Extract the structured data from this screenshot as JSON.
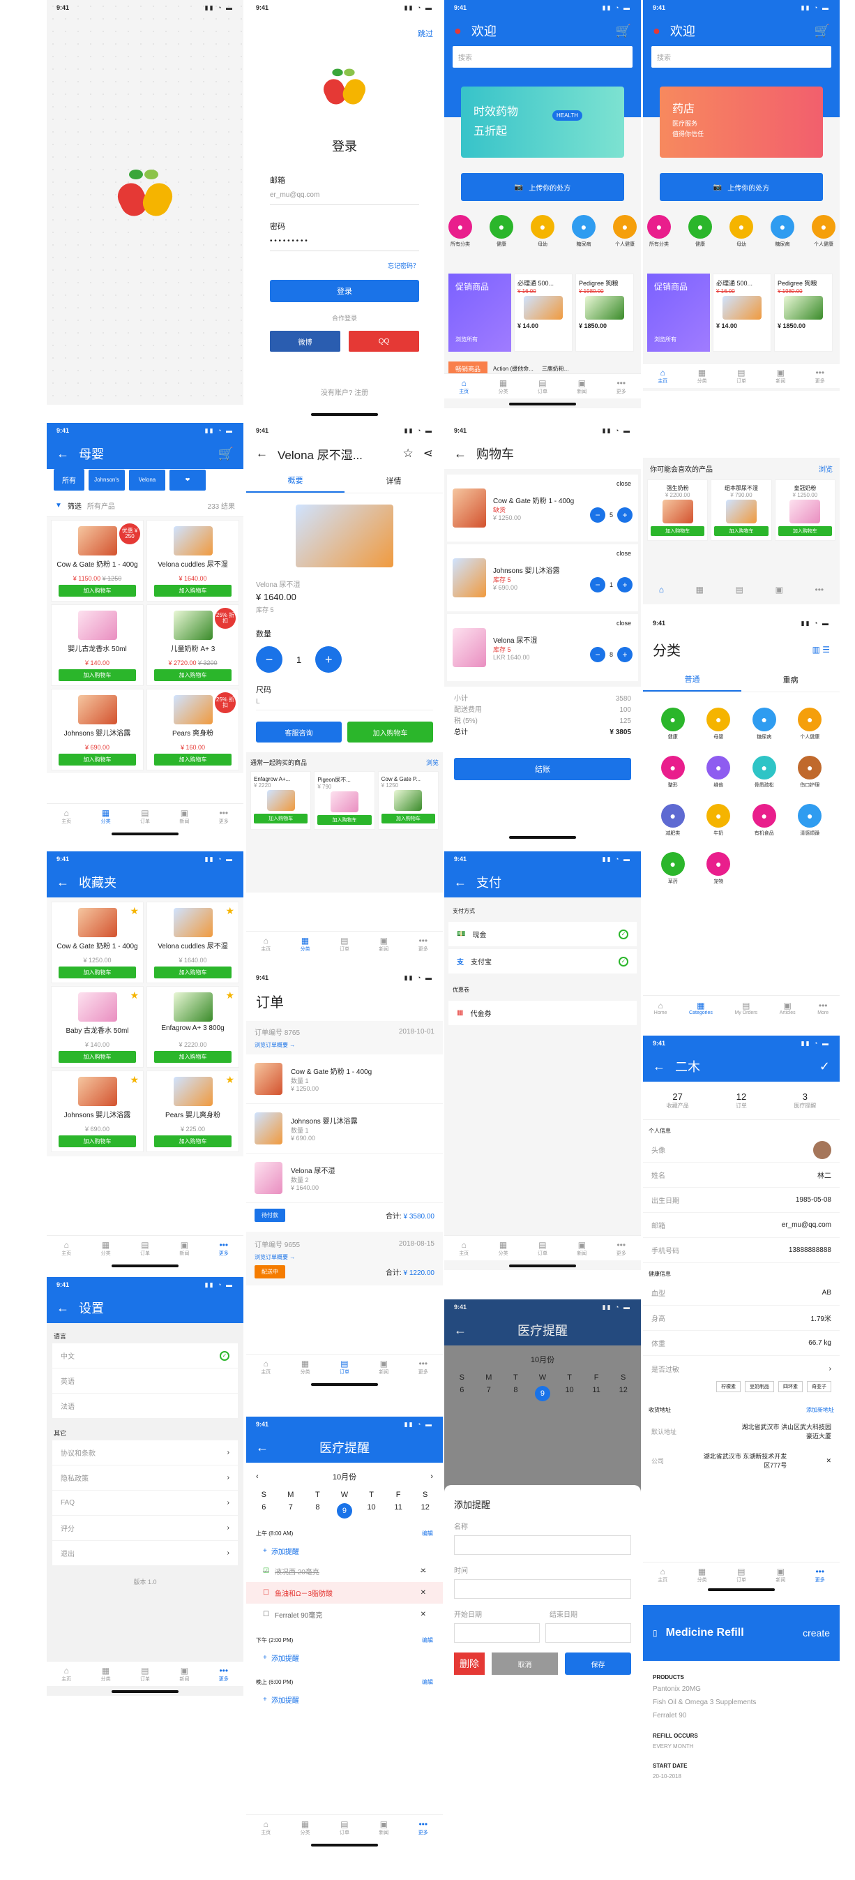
{
  "status_time": "9:41",
  "splash": {},
  "login": {
    "skip": "跳过",
    "title": "登录",
    "email_label": "邮箱",
    "email_value": "er_mu@qq.com",
    "password_label": "密码",
    "password_dots": "• • • • • • • • •",
    "forgot": "忘记密码？",
    "login_btn": "登录",
    "partner": "合作登录",
    "weibo": "微博",
    "qq": "QQ",
    "register": "没有账户? 注册"
  },
  "home1": {
    "title": "欢迎",
    "search": "搜索",
    "banner_line1": "时效药物",
    "banner_line2": "五折起",
    "banner_tag": "HEALTH",
    "upload": "上传你的处方"
  },
  "home2": {
    "title": "欢迎",
    "search": "搜索",
    "banner_line1": "药店",
    "banner_line2": "医疗服务",
    "banner_line3": "值得你信任",
    "upload": "上传你的处方"
  },
  "home_cats": [
    "所有分类",
    "健康",
    "母幼",
    "糖尿病",
    "个人健康"
  ],
  "promo": {
    "title": "促销商品",
    "see_all": "浏览所有",
    "items": [
      {
        "name": "必理通 500...",
        "old": "¥ 16.00",
        "price": "¥ 14.00"
      },
      {
        "name": "Pedigree 狗粮",
        "old": "¥ 1980.00",
        "price": "¥ 1850.00"
      }
    ]
  },
  "home1_extra": {
    "tag": "畅销商品",
    "item1": "Action (缓他命...",
    "item2": "三鹿奶粉..."
  },
  "tabs": {
    "home": "主页",
    "cat": "分类",
    "orders": "订单",
    "news": "新闻",
    "more": "更多"
  },
  "tabs_en": {
    "home": "Home",
    "cat": "Categories",
    "orders": "My Orders",
    "news": "Articles",
    "more": "More"
  },
  "mother": {
    "title": "母婴",
    "tab_all": "所有",
    "filter": "筛选",
    "all_products": "所有产品",
    "count": "233 结果",
    "add": "加入购物车",
    "items": [
      {
        "name": "Cow & Gate 奶粉 1 - 400g",
        "price": "¥ 1150.00",
        "old": "¥ 1250",
        "badge": "优惠 ¥ 250"
      },
      {
        "name": "Velona cuddles 尿不湿",
        "price": "¥ 1640.00",
        "old": "",
        "badge": ""
      },
      {
        "name": "婴儿古龙香水 50ml",
        "price": "¥ 140.00",
        "old": "",
        "badge": ""
      },
      {
        "name": "儿童奶粉 A+ 3",
        "price": "¥ 2720.00",
        "old": "¥ 3200",
        "badge": "25% 折扣"
      },
      {
        "name": "Johnsons 婴儿沐浴露",
        "price": "¥ 690.00",
        "old": "",
        "badge": ""
      },
      {
        "name": "Pears 爽身粉",
        "price": "¥ 160.00",
        "old": "",
        "badge": "25% 折扣"
      }
    ]
  },
  "detail": {
    "title": "Velona 尿不湿...",
    "tab1": "概要",
    "tab2": "详情",
    "name": "Velona 尿不湿",
    "price": "¥ 1640.00",
    "stock": "库存 5",
    "qty_label": "数量",
    "qty": "1",
    "size_label": "尺码",
    "size": "L",
    "service": "客服咨询",
    "add": "加入购物车",
    "together": "通常一起购买的商品",
    "browse": "浏览",
    "related": [
      {
        "name": "Enfagrow A+...",
        "price": "¥ 2220"
      },
      {
        "name": "Pigeon尿不...",
        "price": "¥ 790"
      },
      {
        "name": "Cow & Gate P...",
        "price": "¥ 1250"
      }
    ]
  },
  "cart": {
    "title": "购物车",
    "close": "close",
    "items": [
      {
        "name": "Cow & Gate 奶粉 1 - 400g",
        "stock": "缺货",
        "price": "¥ 1250.00",
        "qty": "5"
      },
      {
        "name": "Johnsons 婴儿沐浴露",
        "stock": "库存 5",
        "price": "¥ 690.00",
        "qty": "1"
      },
      {
        "name": "Velona 尿不湿",
        "stock": "库存 5",
        "price": "LKR 1640.00",
        "qty": "8"
      }
    ],
    "subtotal_l": "小计",
    "subtotal": "3580",
    "ship_l": "配送费用",
    "ship": "100",
    "tax_l": "税 (5%)",
    "tax": "125",
    "total_l": "总计",
    "total": "¥ 3805",
    "checkout": "结账"
  },
  "recommend": {
    "title": "你可能会喜欢的产品",
    "browse": "浏览",
    "items": [
      {
        "name": "强生奶粉",
        "price": "¥ 2200.00"
      },
      {
        "name": "纽本那尿不湿",
        "price": "¥ 790.00"
      },
      {
        "name": "皇冠奶粉",
        "price": "¥ 1250.00"
      }
    ],
    "add": "加入购物车"
  },
  "category": {
    "title": "分类",
    "tab1": "普通",
    "tab2": "重病",
    "items": [
      "健康",
      "母婴",
      "糖尿病",
      "个人健康",
      "整形",
      "维他",
      "骨质疏松",
      "伤口护理",
      "减肥类",
      "牛奶",
      "有机食品",
      "清感烦躁",
      "草药",
      "宠物"
    ]
  },
  "favorites": {
    "title": "收藏夹",
    "add": "加入购物车",
    "items": [
      {
        "name": "Cow & Gate 奶粉 1 - 400g",
        "price": "¥ 1250.00"
      },
      {
        "name": "Velona cuddles 尿不湿",
        "price": "¥ 1640.00"
      },
      {
        "name": "Baby 古龙香水 50ml",
        "price": "¥ 140.00"
      },
      {
        "name": "Enfagrow A+ 3 800g",
        "price": "¥ 2220.00"
      },
      {
        "name": "Johnsons 婴儿沐浴露",
        "price": "¥ 690.00"
      },
      {
        "name": "Pears 婴儿爽身粉",
        "price": "¥ 225.00"
      }
    ]
  },
  "orders": {
    "title": "订单",
    "o1": "订单编号 8765",
    "d1": "2018-10-01",
    "view": "浏览订单概要 →",
    "items": [
      {
        "name": "Cow & Gate 奶粉 1 - 400g",
        "qty": "数量 1",
        "price": "¥ 1250.00"
      },
      {
        "name": "Johnsons 婴儿沐浴露",
        "qty": "数量 1",
        "price": "¥ 690.00"
      },
      {
        "name": "Velona 尿不湿",
        "qty": "数量 2",
        "price": "¥ 1640.00"
      }
    ],
    "status1": "待付款",
    "total1_l": "合计:",
    "total1": "¥ 3580.00",
    "o2": "订单编号 9655",
    "d2": "2018-08-15",
    "status2": "配送中",
    "total2": "¥ 1220.00"
  },
  "pay": {
    "title": "支付",
    "method": "支付方式",
    "cash": "现金",
    "alipay": "支付宝",
    "coupon_l": "优惠卷",
    "coupon": "代金券"
  },
  "profile": {
    "name": "二木",
    "s1": "27",
    "s1l": "收藏产品",
    "s2": "12",
    "s2l": "订单",
    "s3": "3",
    "s3l": "医疗提醒",
    "personal": "个人信息",
    "avatar_l": "头像",
    "name_l": "姓名",
    "name_v": "林二",
    "dob_l": "出生日期",
    "dob": "1985-05-08",
    "email_l": "邮箱",
    "email": "er_mu@qq.com",
    "phone_l": "手机号码",
    "phone": "13888888888",
    "health": "健康信息",
    "blood_l": "血型",
    "blood": "AB",
    "height_l": "身高",
    "height": "1.79米",
    "weight_l": "体重",
    "weight": "66.7 kg",
    "allergy_l": "是否过敏",
    "allergies": [
      "柠檬素",
      "豆奶制品",
      "四环素",
      "奇亚子"
    ],
    "addr_title": "收货地址",
    "addr_add": "添加新地址",
    "addr1_l": "默认地址",
    "addr1": "湖北省武汉市 洪山区武大科技园豪迈大厦",
    "addr2_l": "公司",
    "addr2": "湖北省武汉市 东湖新技术开发区777号"
  },
  "settings": {
    "title": "设置",
    "lang": "语言",
    "langs": [
      "中文",
      "英语",
      "法语"
    ],
    "other": "其它",
    "items": [
      "协议和条款",
      "隐私政策",
      "FAQ",
      "评分",
      "退出"
    ],
    "version": "版本 1.0"
  },
  "reminder": {
    "title": "医疗提醒",
    "month": "10月份",
    "days": [
      "S",
      "M",
      "T",
      "W",
      "T",
      "F",
      "S"
    ],
    "dates": [
      "6",
      "7",
      "8",
      "9",
      "10",
      "11",
      "12"
    ],
    "am": "上午 (8:00 AM)",
    "edit": "编辑",
    "add": "添加提醒",
    "r1": "液况西 20毫克",
    "r2": "鱼油和Ω－3脂肪酸",
    "r3": "Ferralet 90毫克",
    "pm": "下午 (2:00 PM)",
    "night": "晚上 (6:00 PM)"
  },
  "addrem": {
    "title": "添加提醒",
    "name": "名称",
    "time": "时间",
    "start": "开始日期",
    "end": "结束日期",
    "delete": "删除",
    "cancel": "取消",
    "save": "保存"
  },
  "refill": {
    "title": "Medicine Refill",
    "create": "create",
    "products_l": "PRODUCTS",
    "p1": "Pantonix 20MG",
    "p2": "Fish Oil & Omega 3 Supplements",
    "p3": "Ferralet 90",
    "occ_l": "REFILL OCCURS",
    "occ": "EVERY MONTH",
    "start_l": "START DATE",
    "start": "20-10-2018"
  },
  "colors": {
    "primary": "#1a73e8",
    "green": "#2bb62b",
    "red": "#e53935"
  }
}
